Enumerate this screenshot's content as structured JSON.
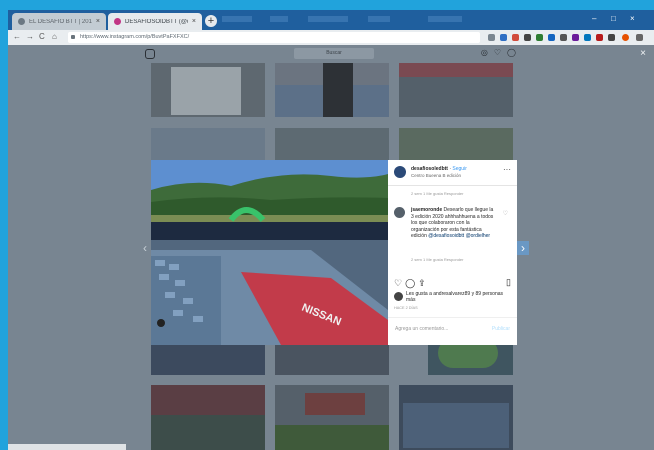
{
  "browser": {
    "tabs": [
      {
        "label": "EL DESAFÍO BTT | 2019 - Desafí..."
      },
      {
        "label": "DESAFIOSOIDBTT (@desafiosoi..."
      }
    ],
    "tab_close": "×",
    "new_tab": "+",
    "address": "https://www.instagram.com/p/BuvtPaFXFXC/",
    "nav": {
      "back": "←",
      "forward": "→",
      "reload": "C",
      "home": "⌂"
    },
    "window_controls": {
      "minimize": "–",
      "maximize": "□",
      "close": "×"
    }
  },
  "instagram": {
    "search_placeholder": "Buscar",
    "close": "×"
  },
  "post": {
    "username": "desafiosoledbtt",
    "follow": "Seguir",
    "location": "Centro Bueena B edición",
    "more": "···",
    "comments": [
      {
        "meta": "2 sem  1 Me gusta  Responder"
      },
      {
        "user": "jsaemoronde",
        "text": "Desearlo que llegue la 3 edición 2020 ahhhahhuena a todos los que colaboraron con la organización por esta fantástica edición",
        "tags": "@desafiosoidbtt @ordielher",
        "meta": "2 sem  1 Me gusta  Responder"
      }
    ],
    "likes_text": "Les gusta a andresalvarez89 y 89 personas más",
    "timestamp": "HACE 2 DÍAS",
    "add_comment_placeholder": "Agrega un comentario...",
    "publish": "Publicar"
  }
}
